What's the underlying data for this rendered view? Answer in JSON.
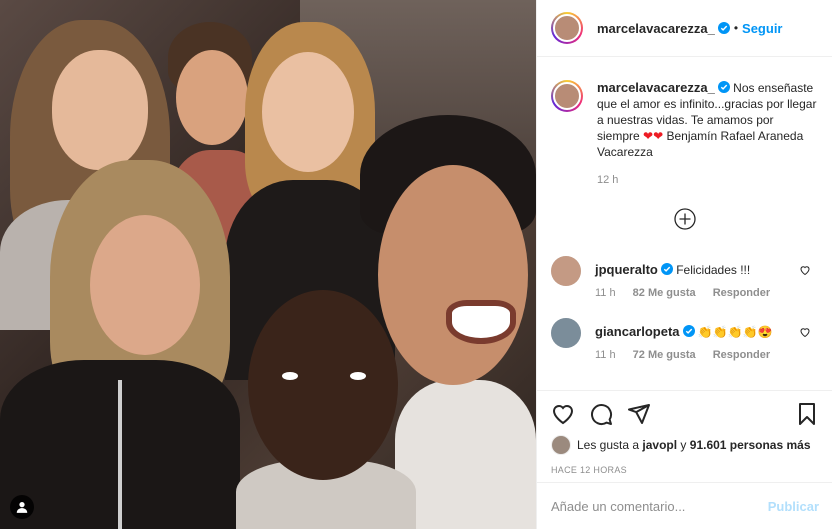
{
  "post": {
    "author": "marcelavacarezza_",
    "follow_label": "Seguir",
    "separator": "•",
    "caption": "Nos enseñaste que el amor es infinito...gracias por llegar a nuestras vidas. Te amamos por siempre",
    "caption_hearts": "❤❤",
    "caption_tail": "Benjamín Rafael Araneda Vacarezza",
    "caption_time": "12 h"
  },
  "comments": [
    {
      "user": "jpqueralto",
      "text": "Felicidades !!!",
      "time": "11 h",
      "likes": "82 Me gusta",
      "reply": "Responder"
    },
    {
      "user": "giancarlopeta",
      "text": "👏👏👏👏😍",
      "time": "11 h",
      "likes": "72 Me gusta",
      "reply": "Responder"
    }
  ],
  "likes": {
    "prefix": "Les gusta a",
    "user": "javopl",
    "conj": "y",
    "count": "91.601 personas más"
  },
  "posted_ago": "HACE 12 HORAS",
  "composer": {
    "placeholder": "Añade un comentario...",
    "publish_label": "Publicar"
  },
  "colors": {
    "link": "#0095f6",
    "publish_disabled": "#b2dffc",
    "muted": "#8e8e8e"
  }
}
